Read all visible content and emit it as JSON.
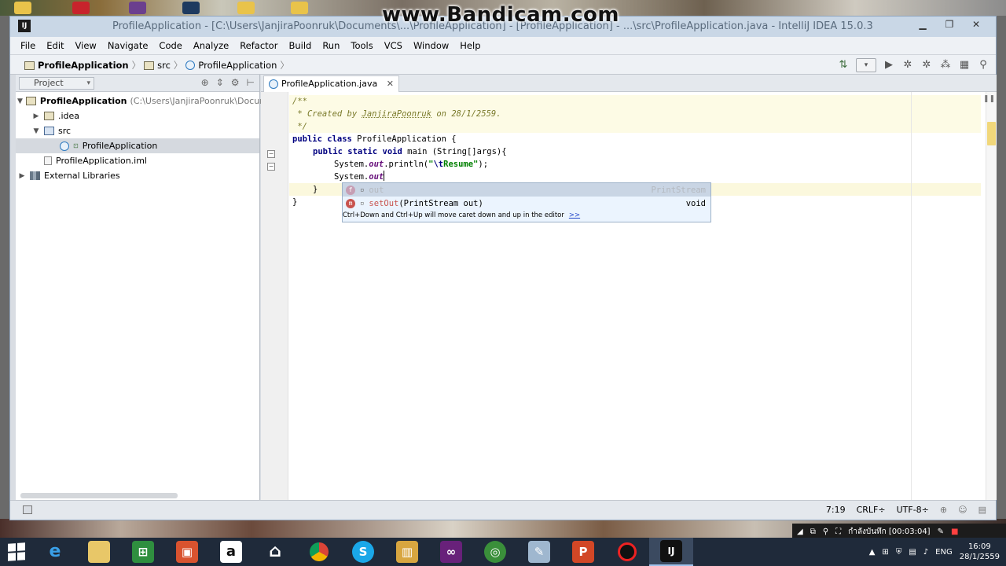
{
  "watermark": "www.Bandicam.com",
  "window": {
    "title": "ProfileApplication - [C:\\Users\\JanjiraPoonruk\\Documents\\...\\ProfileApplication] - [ProfileApplication] - ...\\src\\ProfileApplication.java - IntelliJ IDEA 15.0.3",
    "app_icon": "IJ"
  },
  "menu": [
    "File",
    "Edit",
    "View",
    "Navigate",
    "Code",
    "Analyze",
    "Refactor",
    "Build",
    "Run",
    "Tools",
    "VCS",
    "Window",
    "Help"
  ],
  "breadcrumb": [
    "ProfileApplication",
    "src",
    "ProfileApplication"
  ],
  "project_panel": {
    "tab_label": "Project",
    "tree": [
      {
        "label": "ProfileApplication",
        "path": "(C:\\Users\\JanjiraPoonruk\\Documen",
        "level": 0,
        "arrow": "▼"
      },
      {
        "label": ".idea",
        "level": 1,
        "arrow": "▶"
      },
      {
        "label": "src",
        "level": 1,
        "arrow": "▼"
      },
      {
        "label": "ProfileApplication",
        "level": 2,
        "arrow": ""
      },
      {
        "label": "ProfileApplication.iml",
        "level": 1,
        "arrow": ""
      },
      {
        "label": "External Libraries",
        "level": 0,
        "arrow": "▶"
      }
    ]
  },
  "editor": {
    "tab_label": "ProfileApplication.java",
    "code": {
      "l1": "/**",
      "l2": " * Created by ",
      "l2_author": "JanjiraPoonruk",
      "l2_tail": " on 28/1/2559.",
      "l3": " */",
      "l4_kw": "public class",
      "l4_rest": " ProfileApplication {",
      "l5_kw": "public static void",
      "l5_rest": " main (String[]args){",
      "l6_pre": "System.",
      "l6_field": "out",
      "l6_mid": ".println(",
      "l6_str1": "\"",
      "l6_esc": "\\t",
      "l6_str2": "Resume\"",
      "l6_end": ");",
      "l7_pre": "System.",
      "l7_field": "out",
      "l8": "}",
      "l9": "}"
    }
  },
  "autocomplete": {
    "items": [
      {
        "name": "out",
        "type": "PrintStream"
      },
      {
        "name_hl": "set",
        "name_hl2": "Out",
        "params": "(PrintStream out)",
        "type": "void"
      }
    ],
    "hint": "Ctrl+Down and Ctrl+Up will move caret down and up in the editor",
    "hint_more": ">>"
  },
  "statusbar": {
    "position": "7:19",
    "line_sep": "CRLF÷",
    "encoding": "UTF-8÷"
  },
  "tray": {
    "recording": "กำลังบันทึก [00:03:04]",
    "lang": "ENG",
    "time": "16:09",
    "date": "28/1/2559"
  }
}
